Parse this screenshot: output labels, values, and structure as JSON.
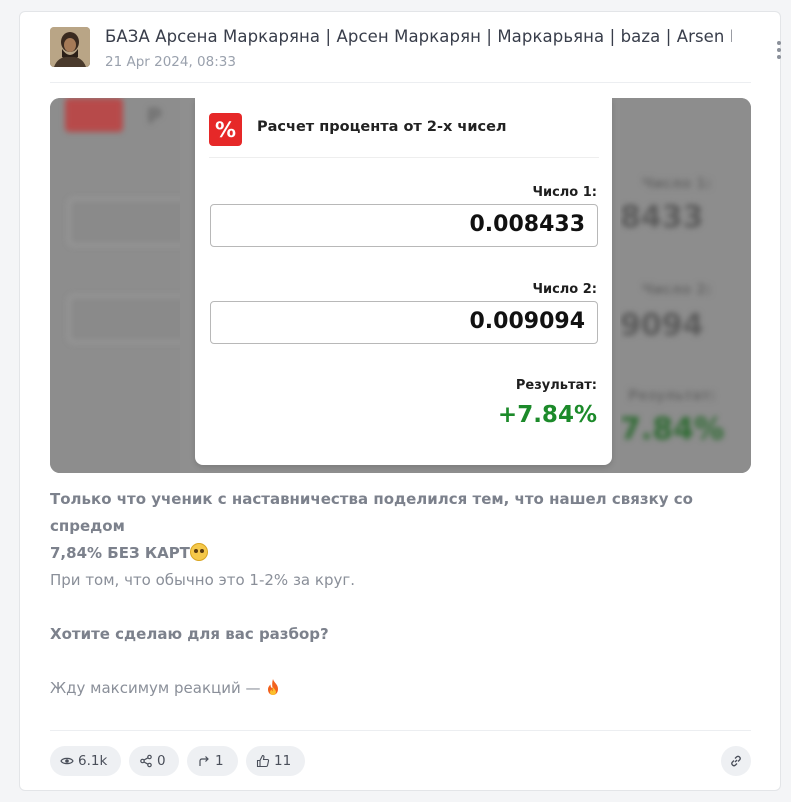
{
  "post": {
    "channel_title": "БАЗА Арсена Маркаряна | Арсен Маркарян | Маркарьяна | baza | Arsen Markaryan",
    "date": "21 Apr 2024, 08:33"
  },
  "media": {
    "calc_title": "Расчет процента от 2-х чисел",
    "percent_symbol": "%",
    "number1_label": "Число 1:",
    "number1_value": "0.008433",
    "number2_label": "Число 2:",
    "number2_value": "0.009094",
    "result_label": "Результат:",
    "result_value": "+7.84%",
    "accent_red": "#e62828",
    "result_green": "#1c8a2a"
  },
  "text": {
    "line1": "Только что ученик с наставничества поделился тем, что нашел связку со спредом",
    "line2": "7,84% БЕЗ КАРТ",
    "line3": "При том, что обычно это 1-2% за круг.",
    "line4": "Хотите сделаю для вас разбор?",
    "line5": "Жду максимум реакций — "
  },
  "footer": {
    "views": "6.1k",
    "shares": "0",
    "forwards": "1",
    "likes": "11",
    "icons": [
      "eye-icon",
      "share-icon",
      "forward-icon",
      "thumbs-up-icon",
      "link-icon"
    ]
  }
}
